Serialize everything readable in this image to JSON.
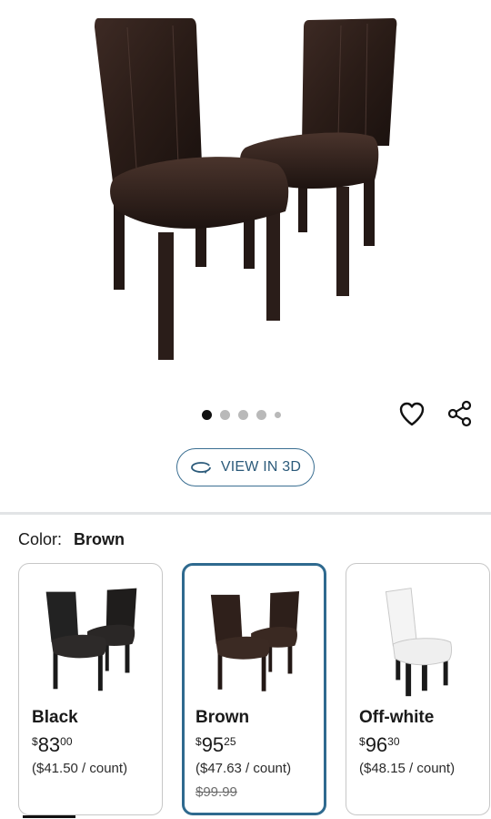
{
  "product": {
    "image_alt": "Two brown faux leather dining chairs",
    "carousel": {
      "total": 5,
      "active": 1
    }
  },
  "actions": {
    "favorite_icon": "heart-icon",
    "share_icon": "share-icon",
    "view3d_label": "VIEW IN 3D",
    "view3d_icon": "rotate-3d-icon"
  },
  "color_selector": {
    "label": "Color:",
    "selected": "Brown",
    "options": [
      {
        "name": "Black",
        "currency": "$",
        "dollars": "83",
        "cents": "00",
        "unit_price": "($41.50 / count)",
        "was_price": "",
        "selected": false,
        "color": "#1c1a19"
      },
      {
        "name": "Brown",
        "currency": "$",
        "dollars": "95",
        "cents": "25",
        "unit_price": "($47.63 / count)",
        "was_price": "$99.99",
        "selected": true,
        "color": "#2a1c17"
      },
      {
        "name": "Off-white",
        "currency": "$",
        "dollars": "96",
        "cents": "30",
        "unit_price": "($48.15 / count)",
        "was_price": "",
        "selected": false,
        "color": "#efefef"
      }
    ]
  },
  "colors": {
    "accent": "#2f6a8f",
    "divider": "#e2e4e6"
  }
}
